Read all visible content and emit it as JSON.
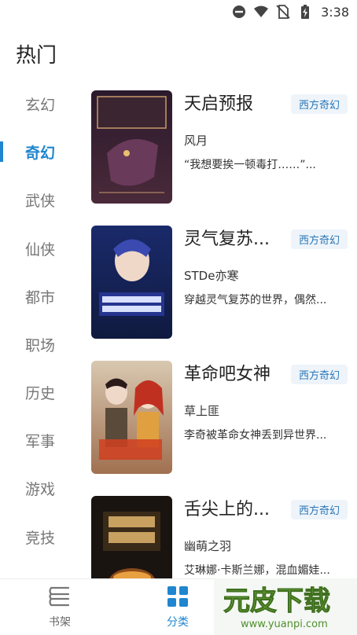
{
  "status": {
    "time": "3:38"
  },
  "header": {
    "title": "热门"
  },
  "sidebar": {
    "items": [
      {
        "label": "玄幻"
      },
      {
        "label": "奇幻"
      },
      {
        "label": "武侠"
      },
      {
        "label": "仙侠"
      },
      {
        "label": "都市"
      },
      {
        "label": "职场"
      },
      {
        "label": "历史"
      },
      {
        "label": "军事"
      },
      {
        "label": "游戏"
      },
      {
        "label": "竞技"
      }
    ],
    "active_label": "奇幻"
  },
  "books": [
    {
      "title": "天启预报",
      "tag": "西方奇幻",
      "author": "风月",
      "desc": "“我想要挨一顿毒打……”..."
    },
    {
      "title": "灵气复苏...",
      "tag": "西方奇幻",
      "author": "STDe亦寒",
      "desc": "穿越灵气复苏的世界，偶然..."
    },
    {
      "title": "革命吧女神",
      "tag": "西方奇幻",
      "author": "草上匪",
      "desc": "李奇被革命女神丢到异世界..."
    },
    {
      "title": "舌尖上的...",
      "tag": "西方奇幻",
      "author": "幽萌之羽",
      "desc": "艾琳娜·卡斯兰娜，混血媚娃..."
    }
  ],
  "bottom_nav": {
    "tabs": [
      {
        "label": "书架",
        "icon": "bookshelf-icon"
      },
      {
        "label": "分类",
        "icon": "category-grid-icon"
      }
    ]
  },
  "watermark": {
    "brand": "元皮下载",
    "url": "www.yuanpi.com"
  },
  "colors": {
    "accent": "#1f86cf",
    "tag_bg": "#eef4fa",
    "tag_text": "#2a77b8"
  }
}
